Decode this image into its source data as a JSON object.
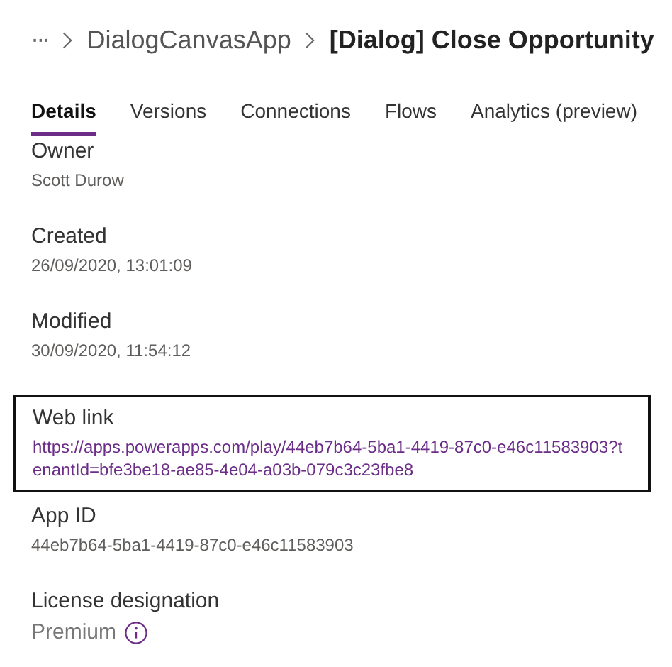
{
  "breadcrumb": {
    "overflow": "···",
    "items": [
      {
        "label": "DialogCanvasApp",
        "current": false
      },
      {
        "label": "[Dialog] Close Opportunity",
        "current": true
      }
    ]
  },
  "tabs": [
    {
      "label": "Details",
      "selected": true
    },
    {
      "label": "Versions",
      "selected": false
    },
    {
      "label": "Connections",
      "selected": false
    },
    {
      "label": "Flows",
      "selected": false
    },
    {
      "label": "Analytics (preview)",
      "selected": false
    }
  ],
  "fields": [
    {
      "label": "Owner",
      "kind": "text",
      "value": "Scott Durow",
      "highlighted": false
    },
    {
      "label": "Created",
      "kind": "text",
      "value": "26/09/2020, 13:01:09",
      "highlighted": false
    },
    {
      "label": "Modified",
      "kind": "text",
      "value": "30/09/2020, 11:54:12",
      "highlighted": false
    },
    {
      "label": "Web link",
      "kind": "link",
      "value": "https://apps.powerapps.com/play/44eb7b64-5ba1-4419-87c0-e46c11583903?tenantId=bfe3be18-ae85-4e04-a03b-079c3c23fbe8",
      "highlighted": true
    },
    {
      "label": "App ID",
      "kind": "text",
      "value": "44eb7b64-5ba1-4419-87c0-e46c11583903",
      "highlighted": false
    },
    {
      "label": "License designation",
      "kind": "info",
      "value": "Premium",
      "highlighted": false
    }
  ]
}
